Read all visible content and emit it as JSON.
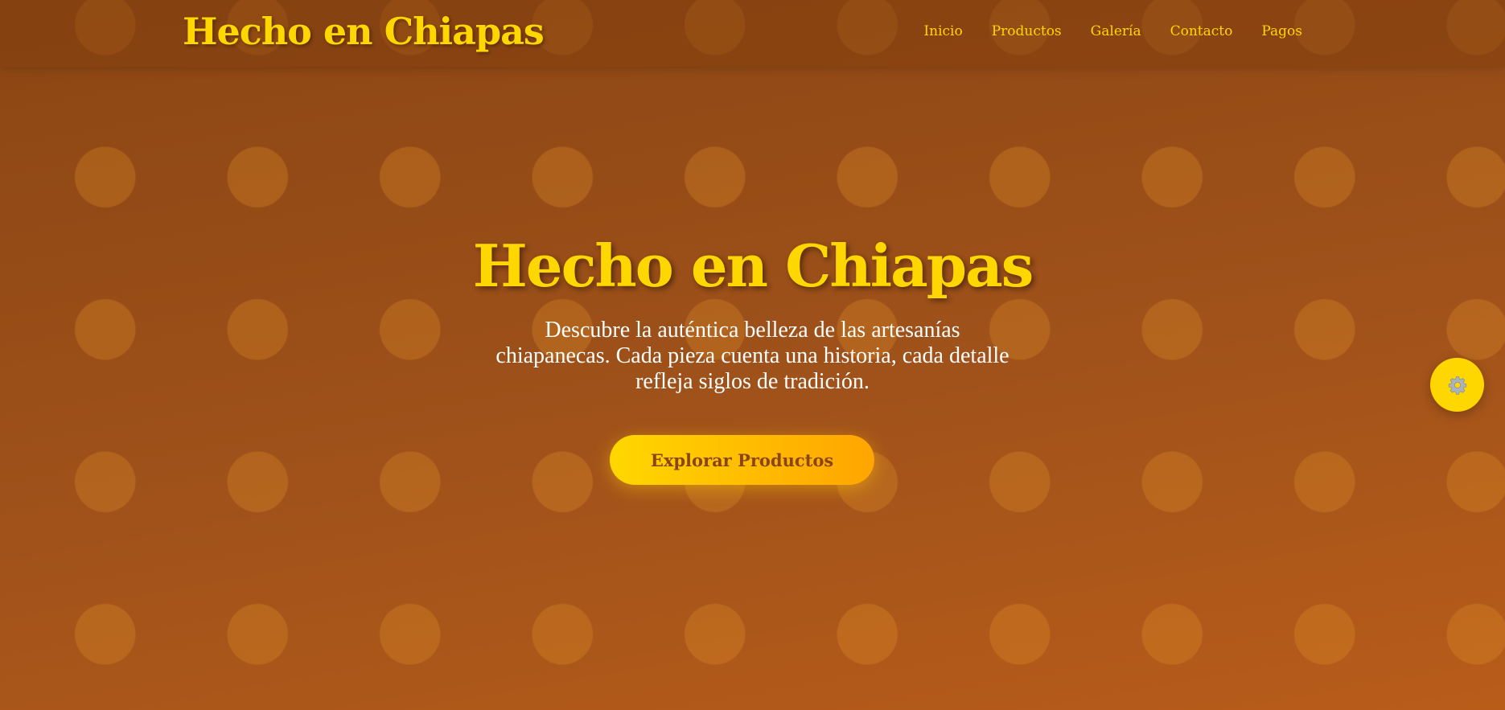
{
  "header": {
    "logo": "Hecho en Chiapas",
    "nav": [
      {
        "label": "Inicio"
      },
      {
        "label": "Productos"
      },
      {
        "label": "Galería"
      },
      {
        "label": "Contacto"
      },
      {
        "label": "Pagos"
      }
    ]
  },
  "hero": {
    "title": "Hecho en Chiapas",
    "description": "Descubre la auténtica belleza de las artesanías chiapanecas. Cada pieza cuenta una historia, cada detalle refleja siglos de tradición.",
    "cta_label": "Explorar Productos"
  },
  "floating_button": {
    "icon": "gear-icon"
  },
  "colors": {
    "background_start": "#8b4513",
    "background_end": "#b85c1a",
    "accent_gold": "#ffd700",
    "accent_orange": "#ffa500",
    "button_text": "#8b4513"
  }
}
